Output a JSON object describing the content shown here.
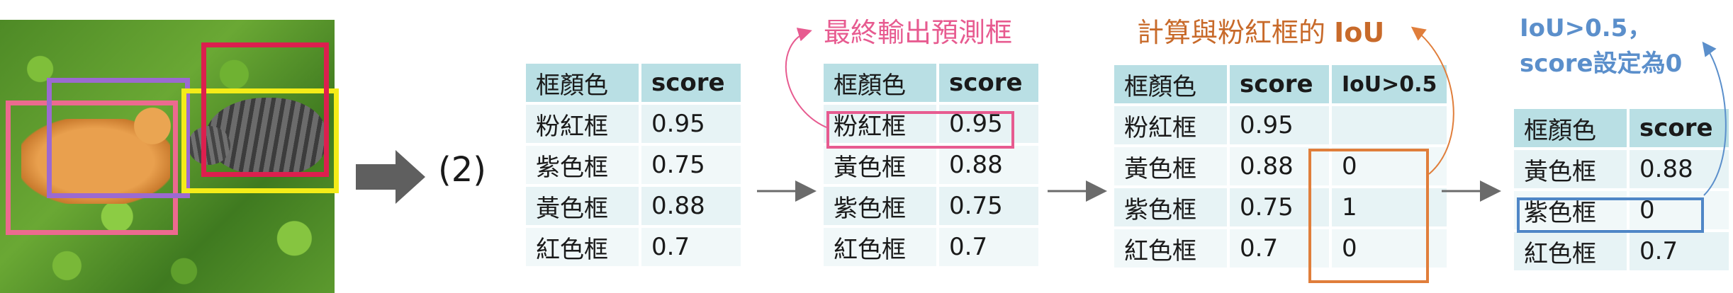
{
  "step_label": "(2)",
  "colors": {
    "pink": "#ec6a8f",
    "purple": "#9b6ad1",
    "yellow": "#f4ec18",
    "red": "#dc1f4e",
    "header_bg": "#b9dfe4",
    "row_bg": "#e7f3f5",
    "note_pink": "#e75b90",
    "note_orange": "#c86a2a",
    "note_blue": "#5b8fcb"
  },
  "table1": {
    "headers": [
      "框顏色",
      "score"
    ],
    "rows": [
      [
        "粉紅框",
        "0.95"
      ],
      [
        "紫色框",
        "0.75"
      ],
      [
        "黃色框",
        "0.88"
      ],
      [
        "紅色框",
        "0.7"
      ]
    ]
  },
  "table2": {
    "headers": [
      "框顏色",
      "score"
    ],
    "rows": [
      [
        "粉紅框",
        "0.95"
      ],
      [
        "黃色框",
        "0.88"
      ],
      [
        "紫色框",
        "0.75"
      ],
      [
        "紅色框",
        "0.7"
      ]
    ]
  },
  "table3": {
    "headers": [
      "框顏色",
      "score",
      "IoU>0.5"
    ],
    "rows": [
      [
        "粉紅框",
        "0.95",
        ""
      ],
      [
        "黃色框",
        "0.88",
        "0"
      ],
      [
        "紫色框",
        "0.75",
        "1"
      ],
      [
        "紅色框",
        "0.7",
        "0"
      ]
    ]
  },
  "table4": {
    "headers": [
      "框顏色",
      "score"
    ],
    "rows": [
      [
        "黃色框",
        "0.88"
      ],
      [
        "紫色框",
        "0"
      ],
      [
        "紅色框",
        "0.7"
      ]
    ]
  },
  "notes": {
    "output": "最終輸出預測框",
    "compute_prefix": "計算與粉紅框的",
    "compute_iou": "IoU",
    "rule_line1": "IoU>0.5，",
    "rule_line2": "score設定為0"
  }
}
